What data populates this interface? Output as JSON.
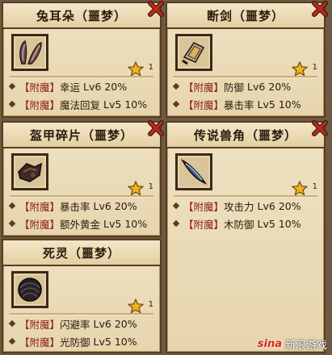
{
  "cards": [
    {
      "title": "兔耳朵（噩梦）",
      "star_count": "1",
      "stats": [
        {
          "tag": "【附魔】",
          "name": "幸运",
          "level": "Lv6",
          "value": "20%"
        },
        {
          "tag": "【附魔】",
          "name": "魔法回复",
          "level": "Lv5",
          "value": "10%"
        }
      ]
    },
    {
      "title": "断剑（噩梦）",
      "star_count": "1",
      "stats": [
        {
          "tag": "【附魔】",
          "name": "防御",
          "level": "Lv6",
          "value": "20%"
        },
        {
          "tag": "【附魔】",
          "name": "暴击率",
          "level": "Lv5",
          "value": "10%"
        }
      ]
    },
    {
      "title": "盔甲碎片（噩梦）",
      "star_count": "1",
      "stats": [
        {
          "tag": "【附魔】",
          "name": "暴击率",
          "level": "Lv6",
          "value": "20%"
        },
        {
          "tag": "【附魔】",
          "name": "额外黄金",
          "level": "Lv5",
          "value": "10%"
        }
      ]
    },
    {
      "title": "传说兽角（噩梦）",
      "star_count": "1",
      "stats": [
        {
          "tag": "【附魔】",
          "name": "攻击力",
          "level": "Lv6",
          "value": "20%"
        },
        {
          "tag": "【附魔】",
          "name": "木防御",
          "level": "Lv5",
          "value": "10%"
        }
      ]
    },
    {
      "title": "死灵（噩梦）",
      "star_count": "1",
      "stats": [
        {
          "tag": "【附魔】",
          "name": "闪避率",
          "level": "Lv6",
          "value": "20%"
        },
        {
          "tag": "【附魔】",
          "name": "光防御",
          "level": "Lv5",
          "value": "10%"
        }
      ]
    }
  ],
  "watermark": {
    "logo": "sina",
    "text": "新浪游戏"
  },
  "colors": {
    "frame": "#5a3d1e",
    "paper": "#efe2c2",
    "close_red": "#c0281c",
    "star": "#f2b21c"
  }
}
